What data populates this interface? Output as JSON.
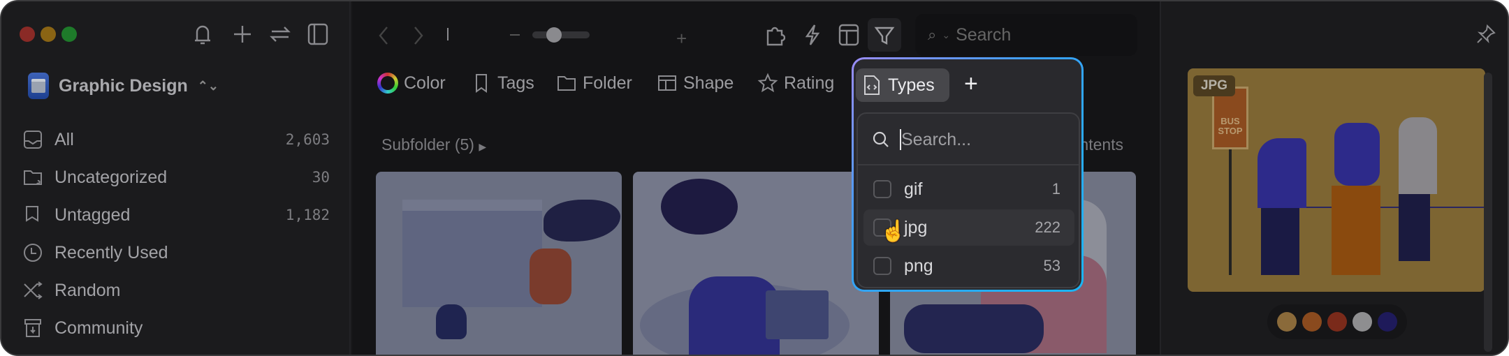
{
  "sidebar": {
    "library": "Graphic Design",
    "items": [
      {
        "label": "All",
        "count": "2,603",
        "icon": "inbox-icon"
      },
      {
        "label": "Uncategorized",
        "count": "30",
        "icon": "folder-question-icon"
      },
      {
        "label": "Untagged",
        "count": "1,182",
        "icon": "tag-question-icon"
      },
      {
        "label": "Recently Used",
        "count": "",
        "icon": "clock-icon"
      },
      {
        "label": "Random",
        "count": "",
        "icon": "shuffle-icon"
      },
      {
        "label": "Community",
        "count": "",
        "icon": "archive-icon"
      }
    ]
  },
  "toolbar": {
    "search_placeholder": "Search",
    "zoom_level": 0.2
  },
  "filters": {
    "color": "Color",
    "tags": "Tags",
    "folder": "Folder",
    "shape": "Shape",
    "rating": "Rating",
    "types": "Types"
  },
  "content": {
    "subfolder": "Subfolder (5)",
    "contents": "Contents"
  },
  "types_popup": {
    "search_placeholder": "Search...",
    "items": [
      {
        "label": "gif",
        "count": "1"
      },
      {
        "label": "jpg",
        "count": "222"
      },
      {
        "label": "png",
        "count": "53"
      }
    ]
  },
  "preview": {
    "badge": "JPG",
    "sign_text": "BUS STOP",
    "palette": [
      "#8a6a3a",
      "#8a4a1e",
      "#7a2a1a",
      "#8e8e90",
      "#1e1a5a"
    ]
  },
  "colors": {
    "accent_start": "#9b8cf7",
    "accent_end": "#19b6f5"
  }
}
